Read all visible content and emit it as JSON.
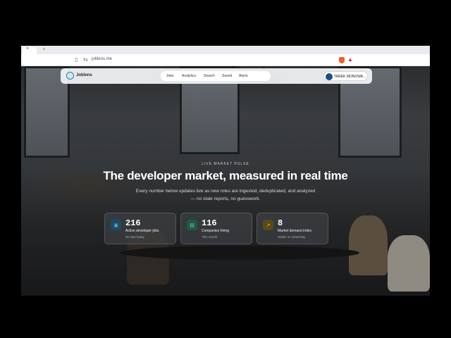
{
  "browser": {
    "tab": {
      "close_glyph": "×",
      "new_tab_glyph": "+"
    },
    "toolbar": {
      "url": "joblens.me",
      "icons": [
        "page-icon",
        "site-info-icon",
        "brave-shield-icon",
        "notification-icon"
      ]
    }
  },
  "nav": {
    "logo_text": "Joblens",
    "links": [
      "Jobs",
      "Analytics",
      "Search",
      "Saved",
      "Alerts"
    ],
    "user": {
      "initials": "TM",
      "name": "TAREK MONOWA..."
    }
  },
  "hero": {
    "eyebrow": "LIVE MARKET PULSE",
    "headline": "The developer market, measured in real time",
    "subhead": "Every number below updates live as new roles are ingested, deduplicated, and analyzed — no stale reports, no guesswork."
  },
  "stats": [
    {
      "icon": "briefcase-icon",
      "glyph": "▣",
      "value": "216",
      "label": "Active developer jobs",
      "sub": "35 new today",
      "color": "#4fb3e6"
    },
    {
      "icon": "building-icon",
      "glyph": "▤",
      "value": "116",
      "label": "Companies hiring",
      "sub": "This month",
      "color": "#5bd39a"
    },
    {
      "icon": "trend-up-icon",
      "glyph": "↗",
      "value": "8",
      "label": "Market demand index",
      "sub": "Stable vs yesterday",
      "color": "#e7c34b"
    }
  ]
}
